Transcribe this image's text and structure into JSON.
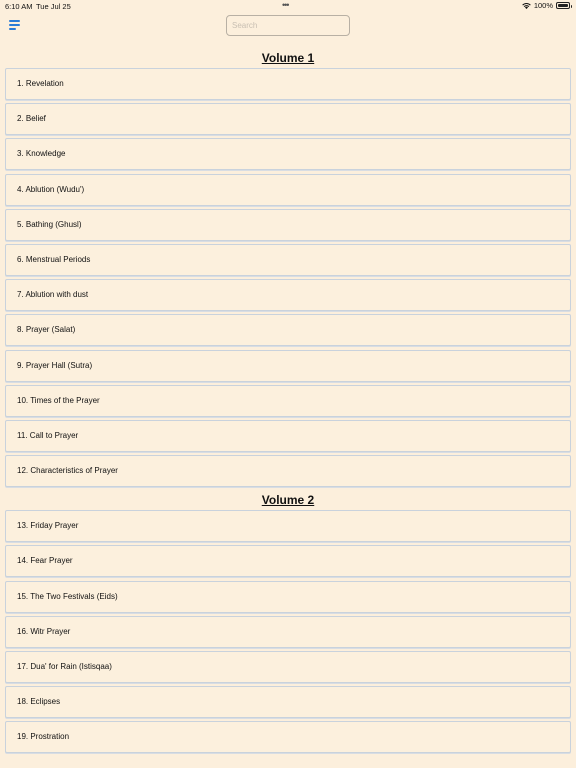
{
  "status": {
    "time": "6:10 AM",
    "date": "Tue Jul 25",
    "battery": "100%"
  },
  "header": {
    "search_placeholder": "Search"
  },
  "volumes": [
    {
      "title": "Volume 1",
      "chapters": [
        "1. Revelation",
        "2. Belief",
        "3. Knowledge",
        "4. Ablution (Wudu')",
        "5. Bathing (Ghusl)",
        "6. Menstrual Periods",
        "7. Ablution with dust",
        "8. Prayer (Salat)",
        "9. Prayer Hall (Sutra)",
        "10. Times of the Prayer",
        "11. Call to Prayer",
        "12. Characteristics of Prayer"
      ]
    },
    {
      "title": "Volume 2",
      "chapters": [
        "13. Friday Prayer",
        "14. Fear Prayer",
        "15. The Two Festivals (Eids)",
        "16. Witr Prayer",
        "17. Dua' for Rain (Istisqaa)",
        "18. Eclipses",
        "19. Prostration"
      ]
    }
  ]
}
